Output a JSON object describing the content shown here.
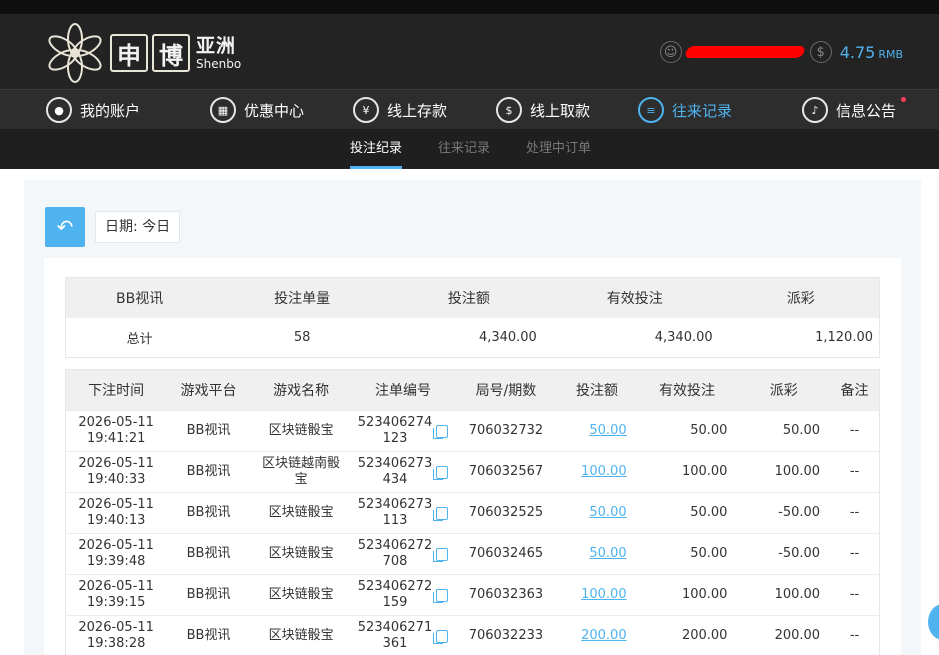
{
  "brand": {
    "box1": "申",
    "box2": "博",
    "cn": "亚洲",
    "en": "Shenbo"
  },
  "account": {
    "balance": "4.75",
    "currency": "RMB"
  },
  "nav": [
    {
      "label": "我的账户",
      "icon": "user-icon"
    },
    {
      "label": "优惠中心",
      "icon": "gift-icon"
    },
    {
      "label": "线上存款",
      "icon": "deposit-icon"
    },
    {
      "label": "线上取款",
      "icon": "withdraw-icon"
    },
    {
      "label": "往来记录",
      "icon": "records-icon"
    },
    {
      "label": "信息公告",
      "icon": "bell-icon"
    }
  ],
  "subnav": [
    {
      "label": "投注纪录"
    },
    {
      "label": "往来记录"
    },
    {
      "label": "处理中订单"
    }
  ],
  "filter": {
    "date_label": "日期: 今日"
  },
  "summary": {
    "headers": [
      "BB视讯",
      "投注单量",
      "投注额",
      "有效投注",
      "派彩"
    ],
    "row": {
      "label": "总计",
      "count": "58",
      "bet": "4,340.00",
      "valid": "4,340.00",
      "payout": "1,120.00"
    }
  },
  "records": {
    "headers": [
      "下注时间",
      "游戏平台",
      "游戏名称",
      "注单编号",
      "局号/期数",
      "投注额",
      "有效投注",
      "派彩",
      "备注"
    ],
    "rows": [
      {
        "date": "2026-05-11",
        "time": "19:41:21",
        "platform": "BB视讯",
        "game": "区块链骰宝",
        "order1": "523406274",
        "order2": "123",
        "round": "706032732",
        "bet": "50.00",
        "valid": "50.00",
        "payout": "50.00",
        "note": "--"
      },
      {
        "date": "2026-05-11",
        "time": "19:40:33",
        "platform": "BB视讯",
        "game": "区块链越南骰宝",
        "order1": "523406273",
        "order2": "434",
        "round": "706032567",
        "bet": "100.00",
        "valid": "100.00",
        "payout": "100.00",
        "note": "--"
      },
      {
        "date": "2026-05-11",
        "time": "19:40:13",
        "platform": "BB视讯",
        "game": "区块链骰宝",
        "order1": "523406273",
        "order2": "113",
        "round": "706032525",
        "bet": "50.00",
        "valid": "50.00",
        "payout": "-50.00",
        "note": "--"
      },
      {
        "date": "2026-05-11",
        "time": "19:39:48",
        "platform": "BB视讯",
        "game": "区块链骰宝",
        "order1": "523406272",
        "order2": "708",
        "round": "706032465",
        "bet": "50.00",
        "valid": "50.00",
        "payout": "-50.00",
        "note": "--"
      },
      {
        "date": "2026-05-11",
        "time": "19:39:15",
        "platform": "BB视讯",
        "game": "区块链骰宝",
        "order1": "523406272",
        "order2": "159",
        "round": "706032363",
        "bet": "100.00",
        "valid": "100.00",
        "payout": "100.00",
        "note": "--"
      },
      {
        "date": "2026-05-11",
        "time": "19:38:28",
        "platform": "BB视讯",
        "game": "区块链骰宝",
        "order1": "523406271",
        "order2": "361",
        "round": "706032233",
        "bet": "200.00",
        "valid": "200.00",
        "payout": "200.00",
        "note": "--"
      }
    ]
  }
}
